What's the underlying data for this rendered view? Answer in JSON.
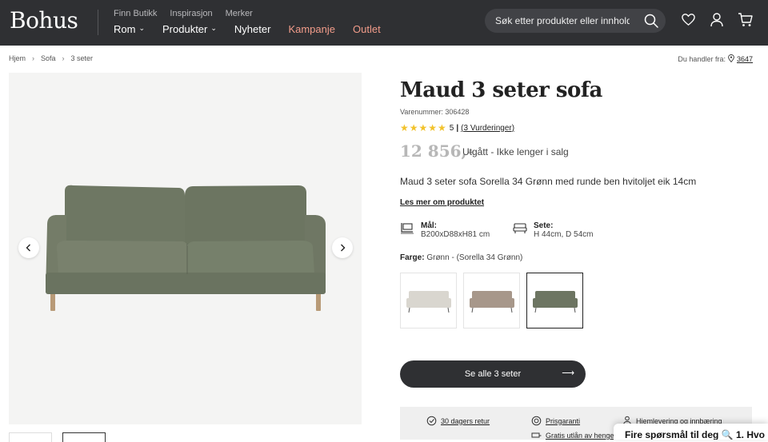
{
  "header": {
    "logo": "Bohus",
    "top_links": [
      "Finn Butikk",
      "Inspirasjon",
      "Merker"
    ],
    "nav": [
      {
        "label": "Rom",
        "dropdown": true
      },
      {
        "label": "Produkter",
        "dropdown": true
      },
      {
        "label": "Nyheter",
        "dropdown": false
      },
      {
        "label": "Kampanje",
        "dropdown": false
      },
      {
        "label": "Outlet",
        "dropdown": false
      }
    ],
    "search_placeholder": "Søk etter produkter eller innhold ...",
    "icons": [
      "search-icon",
      "heart-icon",
      "user-icon",
      "cart-icon"
    ],
    "accent_color": "#f29c8a"
  },
  "breadcrumb": [
    "Hjem",
    "Sofa",
    "3 seter"
  ],
  "store": {
    "label": "Du handler fra:",
    "number": "3647"
  },
  "product": {
    "title": "Maud 3 seter sofa",
    "sku": "Varenummer: 306428",
    "rating_value": "5",
    "rating_count": "(3 Vurderinger)",
    "stars": 5,
    "price": "12 856,-",
    "status": "Utgått - Ikke lenger i salg",
    "description": "Maud 3 seter sofa Sorella 34 Grønn med runde ben hvitoljet eik 14cm",
    "read_more": "Les mer om produktet",
    "specs": [
      {
        "title": "Mål:",
        "value": "B200xD88xH81 cm",
        "icon": "dimensions-icon"
      },
      {
        "title": "Sete:",
        "value": "H 44cm, D 54cm",
        "icon": "seat-icon"
      }
    ],
    "color_label": "Farge:",
    "color_value": "Grønn - (Sorella 34 Grønn)",
    "swatches": [
      {
        "name": "Beige",
        "color": "#d9d6cf",
        "selected": false
      },
      {
        "name": "Brun",
        "color": "#a7978a",
        "selected": false
      },
      {
        "name": "Grønn",
        "color": "#6d7562",
        "selected": true
      }
    ],
    "cta": "Se alle 3 seter"
  },
  "usp": [
    {
      "label": "30 dagers retur",
      "icon": "return-icon"
    },
    {
      "label": "Prisgaranti",
      "icon": "price-guarantee-icon"
    },
    {
      "label": "Hjemlevering og innbæring",
      "icon": "delivery-icon"
    },
    {
      "label": "Gratis utlån av henger",
      "icon": "trailer-icon"
    }
  ],
  "chat": {
    "text": "Fire spørsmål til deg 🔍 1. Hvo"
  },
  "sofa_color": "#707965"
}
